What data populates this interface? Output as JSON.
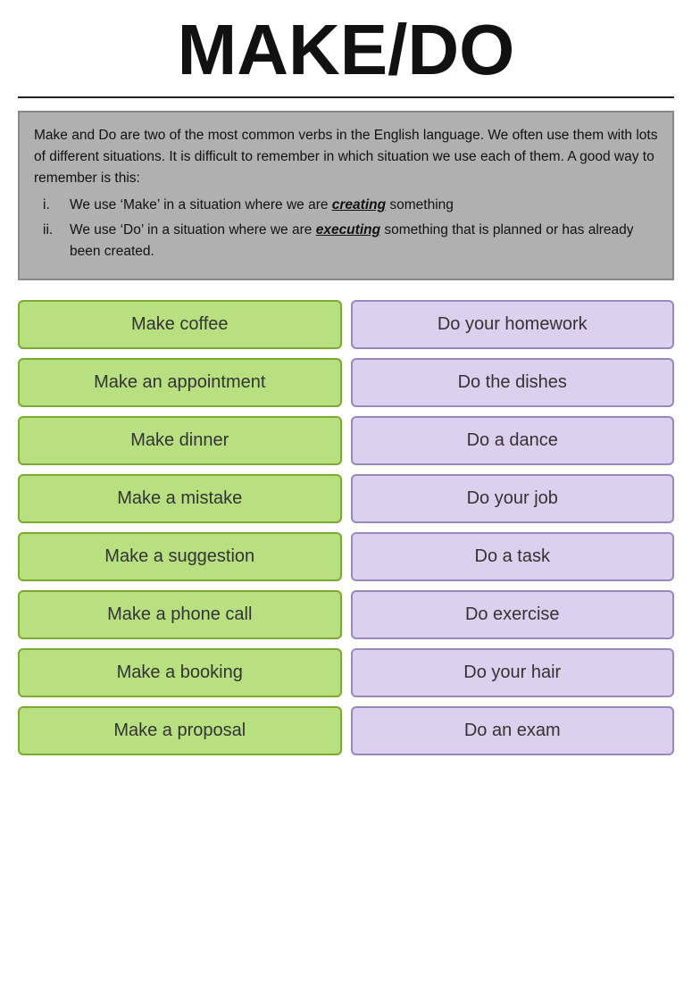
{
  "title": "MAKE/DO",
  "intro": {
    "paragraph": "Make and Do are two of the most common verbs in the English language. We often use them with lots of different situations. It is difficult to remember in which situation we use each of them. A good way to remember is this:",
    "rules": [
      {
        "num": "i.",
        "before": "We use ‘Make’ in a situation where we are ",
        "keyword": "creating",
        "after": " something"
      },
      {
        "num": "ii.",
        "before": "We use ‘Do’ in a situation where we are ",
        "keyword": "executing",
        "after": " something that is planned or has already been created."
      }
    ]
  },
  "pairs": [
    {
      "make": "Make coffee",
      "do": "Do your homework"
    },
    {
      "make": "Make an appointment",
      "do": "Do the dishes"
    },
    {
      "make": "Make dinner",
      "do": "Do a dance"
    },
    {
      "make": "Make a mistake",
      "do": "Do your job"
    },
    {
      "make": "Make a suggestion",
      "do": "Do a task"
    },
    {
      "make": "Make a phone call",
      "do": "Do exercise"
    },
    {
      "make": "Make a booking",
      "do": "Do your hair"
    },
    {
      "make": "Make a proposal",
      "do": "Do an exam"
    }
  ]
}
